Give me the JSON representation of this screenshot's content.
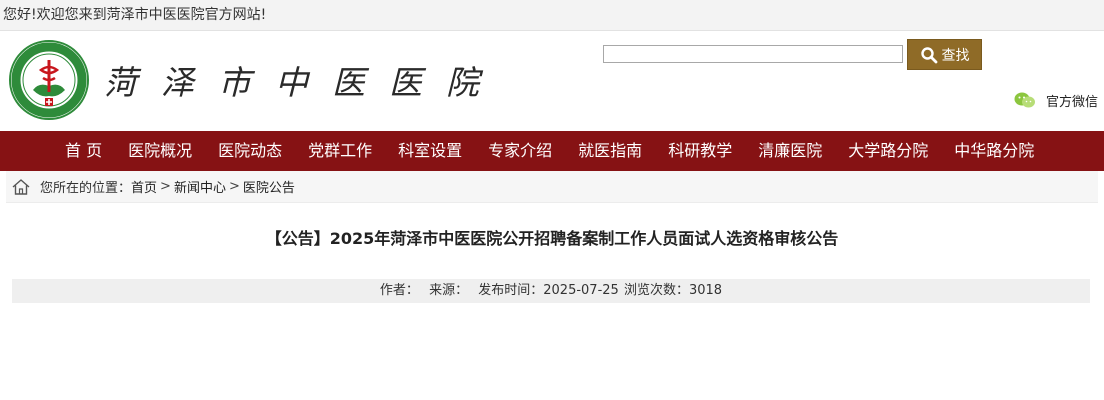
{
  "topbar": {
    "welcome": "您好!欢迎您来到菏泽市中医医院官方网站!"
  },
  "header": {
    "site_name": "菏泽市中医医院",
    "search": {
      "placeholder": "",
      "button_label": "查找"
    },
    "wechat_label": "官方微信"
  },
  "nav": {
    "items": [
      "首 页",
      "医院概况",
      "医院动态",
      "党群工作",
      "科室设置",
      "专家介绍",
      "就医指南",
      "科研教学",
      "清廉医院",
      "大学路分院",
      "中华路分院"
    ]
  },
  "breadcrumb": {
    "prefix": "您所在的位置：",
    "items": [
      "首页",
      "新闻中心",
      "医院公告"
    ],
    "separator": ">"
  },
  "article": {
    "title": "【公告】2025年菏泽市中医医院公开招聘备案制工作人员面试人选资格审核公告",
    "meta": {
      "author_label": "作者：",
      "source_label": "来源：",
      "date_label": "发布时间：",
      "date": "2025-07-25",
      "views_label": "浏览次数：",
      "views": "3018"
    }
  },
  "colors": {
    "nav_bg": "#861214",
    "search_button": "#8f6b27",
    "logo_green": "#2e8b3a",
    "logo_red": "#c8161d"
  },
  "icons": {
    "search": "magnifier-icon",
    "wechat": "wechat-icon",
    "home": "home-icon"
  }
}
